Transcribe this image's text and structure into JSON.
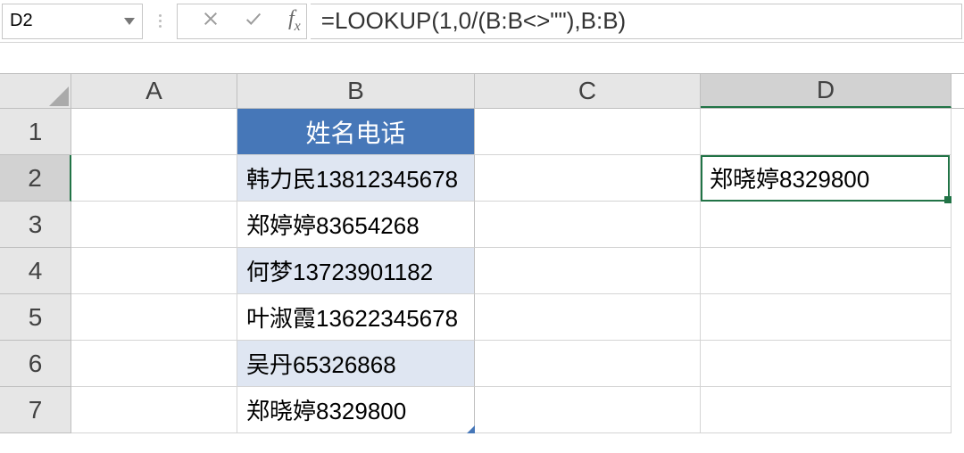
{
  "name_box": {
    "value": "D2"
  },
  "formula_bar": {
    "value": "=LOOKUP(1,0/(B:B<>\"\"),B:B)",
    "fx_label": "fx"
  },
  "columns": {
    "A": "A",
    "B": "B",
    "C": "C",
    "D": "D"
  },
  "row_labels": [
    "1",
    "2",
    "3",
    "4",
    "5",
    "6",
    "7"
  ],
  "table": {
    "header": "姓名电话",
    "rows": [
      "韩力民13812345678",
      "郑婷婷83654268",
      "何梦13723901182",
      "叶淑霞13622345678",
      "吴丹65326868",
      "郑晓婷8329800"
    ]
  },
  "d2_value": "郑晓婷8329800",
  "chart_data": {
    "type": "table",
    "title": "姓名电话",
    "rows": [
      "韩力民13812345678",
      "郑婷婷83654268",
      "何梦13723901182",
      "叶淑霞13622345678",
      "吴丹65326868",
      "郑晓婷8329800"
    ],
    "active_cell": "D2",
    "formula_result": "郑晓婷8329800"
  }
}
